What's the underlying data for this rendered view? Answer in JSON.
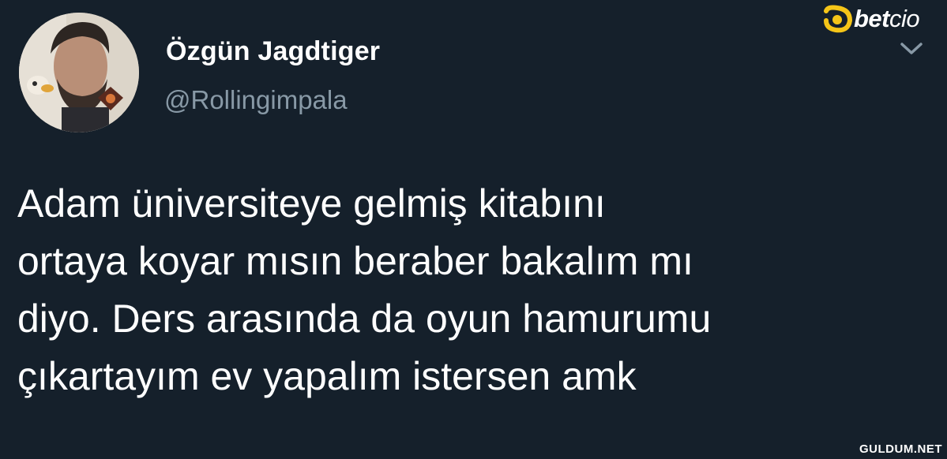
{
  "tweet": {
    "author_name": "Özgün Jagdtiger",
    "author_handle": "@Rollingimpala",
    "text_lines": [
      "Adam üniversiteye gelmiş kitabını",
      "ortaya koyar mısın beraber bakalım mı",
      "diyo. Ders arasında da oyun hamurumu",
      "çıkartayım ev yapalım istersen amk"
    ]
  },
  "icons": {
    "menu": "chevron-down-icon"
  },
  "overlays": {
    "brand_logo": {
      "bold": "bet",
      "light": "cio"
    },
    "watermark": "GULDUM.NET"
  },
  "colors": {
    "background": "#15202b",
    "primary_text": "#ffffff",
    "secondary_text": "#8899a6",
    "brand_accent": "#f5c518"
  }
}
